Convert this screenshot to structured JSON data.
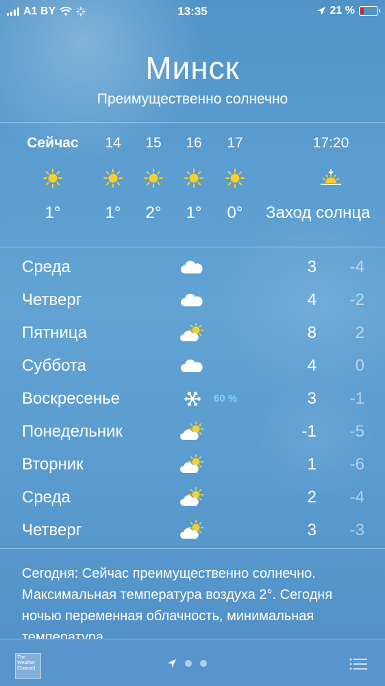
{
  "status_bar": {
    "carrier": "A1 BY",
    "time": "13:35",
    "battery_percent": "21 %",
    "battery_level": 0.21
  },
  "location": {
    "city": "Минск",
    "condition": "Преимущественно солнечно"
  },
  "hourly": [
    {
      "label": "Сейчас",
      "icon": "sun-icon",
      "temp": "1°"
    },
    {
      "label": "14",
      "icon": "sun-icon",
      "temp": "1°"
    },
    {
      "label": "15",
      "icon": "sun-icon",
      "temp": "2°"
    },
    {
      "label": "16",
      "icon": "sun-icon",
      "temp": "1°"
    },
    {
      "label": "17",
      "icon": "sun-icon",
      "temp": "0°"
    },
    {
      "label": "17:20",
      "icon": "sunset-icon",
      "temp": "Заход солнца"
    }
  ],
  "daily": [
    {
      "day": "Среда",
      "icon": "cloud-icon",
      "precip": "",
      "high": "3",
      "low": "-4"
    },
    {
      "day": "Четверг",
      "icon": "cloud-icon",
      "precip": "",
      "high": "4",
      "low": "-2"
    },
    {
      "day": "Пятница",
      "icon": "partly-sunny-icon",
      "precip": "",
      "high": "8",
      "low": "2"
    },
    {
      "day": "Суббота",
      "icon": "cloud-icon",
      "precip": "",
      "high": "4",
      "low": "0"
    },
    {
      "day": "Воскресенье",
      "icon": "snowflake-icon",
      "precip": "60 %",
      "high": "3",
      "low": "-1"
    },
    {
      "day": "Понедельник",
      "icon": "partly-sunny-icon",
      "precip": "",
      "high": "-1",
      "low": "-5"
    },
    {
      "day": "Вторник",
      "icon": "partly-sunny-icon",
      "precip": "",
      "high": "1",
      "low": "-6"
    },
    {
      "day": "Среда",
      "icon": "partly-sunny-icon",
      "precip": "",
      "high": "2",
      "low": "-4"
    },
    {
      "day": "Четверг",
      "icon": "partly-sunny-icon",
      "precip": "",
      "high": "3",
      "low": "-3"
    }
  ],
  "summary": "Сегодня: Сейчас преимущественно солнечно. Максимальная температура воздуха 2°. Сегодня ночью переменная облачность, минимальная температура",
  "bottom_bar": {
    "logo_text": "The Weather Channel"
  },
  "colors": {
    "sun": "#f7d02c",
    "precip": "#7fd3ff",
    "battery_low": "#e02020"
  }
}
